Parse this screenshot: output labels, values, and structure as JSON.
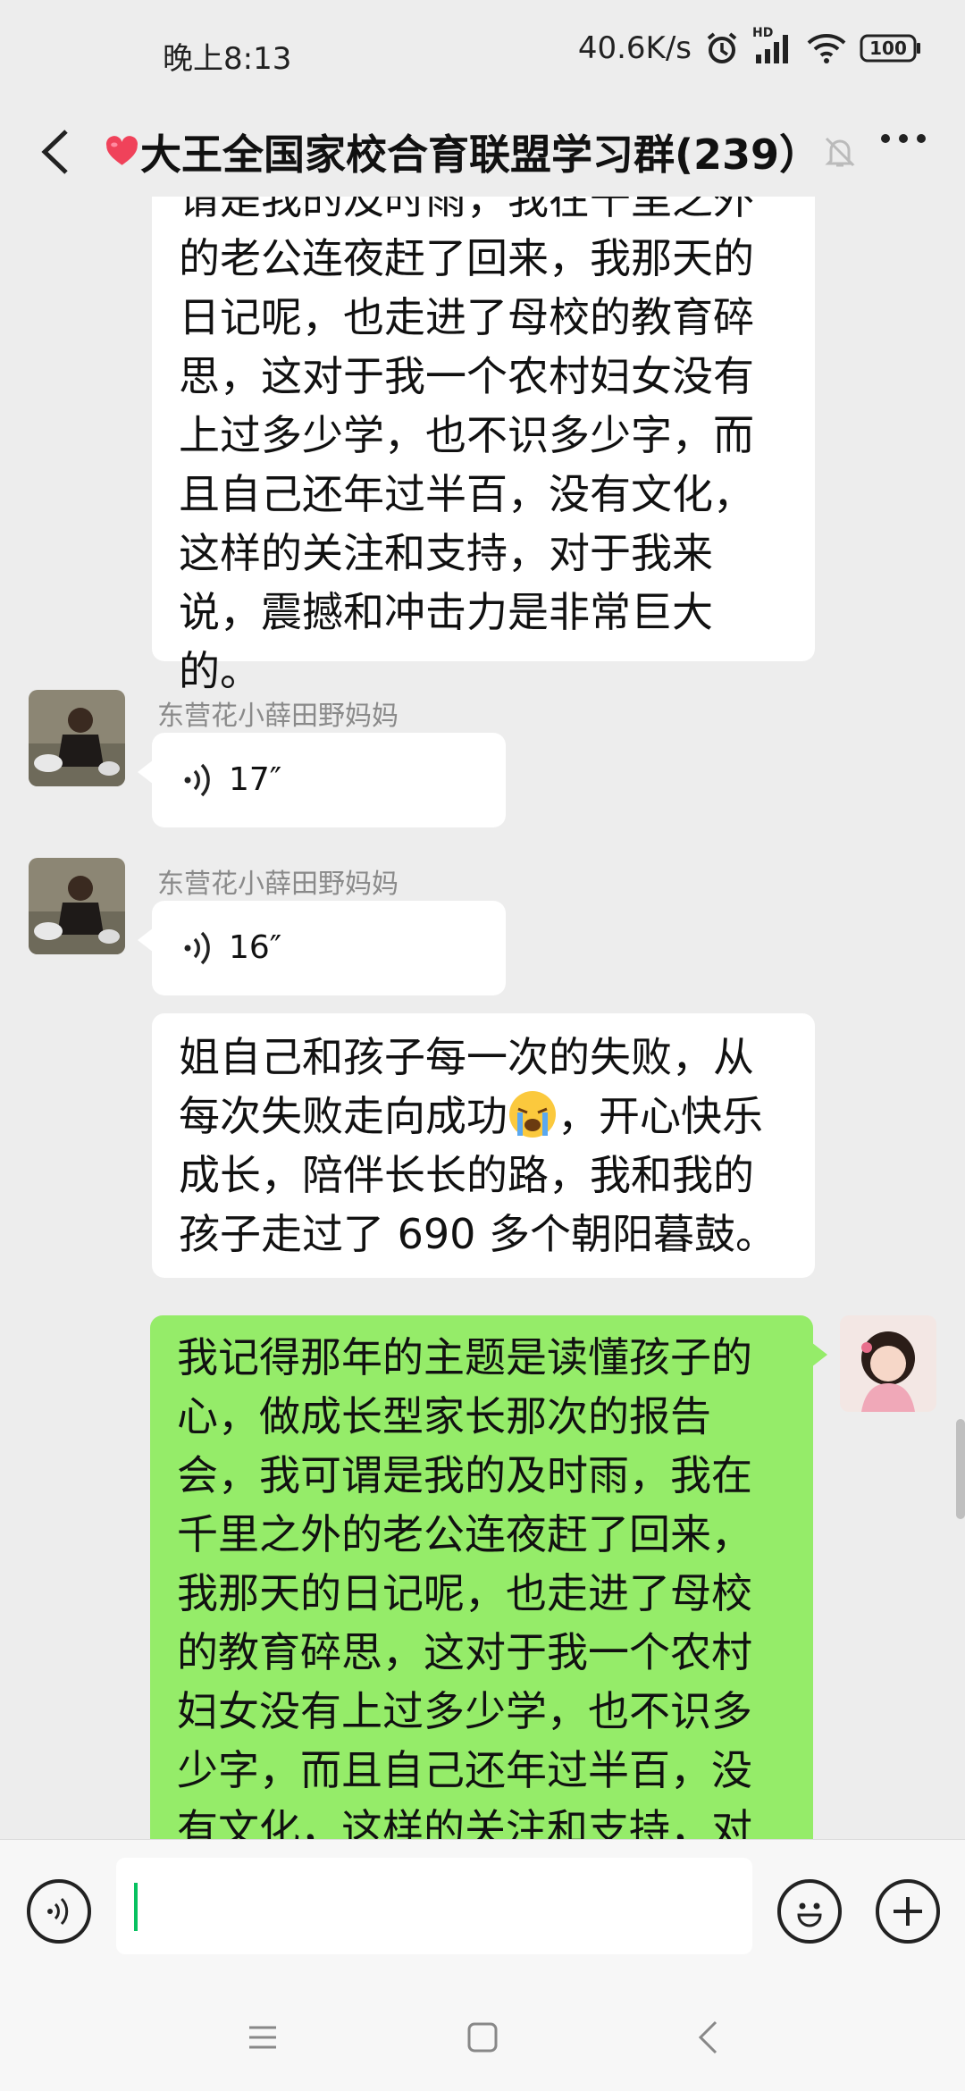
{
  "status_bar": {
    "time": "晚上8:13",
    "network_speed": "40.6K/s",
    "signal_label": "HD",
    "battery": "100"
  },
  "header": {
    "title": "大王全国家校合育联盟学习群(239）",
    "heart_icon": "heart-emoji"
  },
  "messages": [
    {
      "type": "text",
      "side": "left",
      "text": "请是我的及时雨，我在千里之外的老公连夜赶了回来，我那天的日记呢，也走进了母校的教育碎思，这对于我一个农村妇女没有上过多少学，也不识多少字，而且自己还年过半百，没有文化，这样的关注和支持，对于我来说，震撼和冲击力是非常巨大的。"
    },
    {
      "type": "voice",
      "side": "left",
      "sender": "东营花小薛田野妈妈",
      "duration": "17″"
    },
    {
      "type": "voice",
      "side": "left",
      "sender": "东营花小薛田野妈妈",
      "duration": "16″"
    },
    {
      "type": "text",
      "side": "left",
      "text_before_emoji": "姐自己和孩子每一次的失败，从每次失败走向成功",
      "emoji": "loudly-crying-face",
      "text_after_emoji": "，开心快乐成长，陪伴长长的路，我和我的孩子走过了 690 多个朝阳暮鼓。"
    },
    {
      "type": "text",
      "side": "right",
      "text": "我记得那年的主题是读懂孩子的心，做成长型家长那次的报告会，我可谓是我的及时雨，我在千里之外的老公连夜赶了回来，我那天的日记呢，也走进了母校的教育碎思，这对于我一个农村妇女没有上过多少学，也不识多少字，而且自己还年过半百，没有文化，这样的关注和支持，对于我来说，震撼和冲击力是非常巨大的。"
    }
  ],
  "colors": {
    "sent_bubble": "#95ec69",
    "received_bubble": "#ffffff",
    "background": "#ededed",
    "caret": "#07c160"
  },
  "input_bar": {
    "voice_icon": "voice-mode-icon",
    "emoji_icon": "emoji-face-icon",
    "plus_icon": "plus-icon"
  },
  "nav_bar": {
    "menu_icon": "menu-icon",
    "home_icon": "home-square-icon",
    "back_icon": "back-chevron-icon"
  }
}
